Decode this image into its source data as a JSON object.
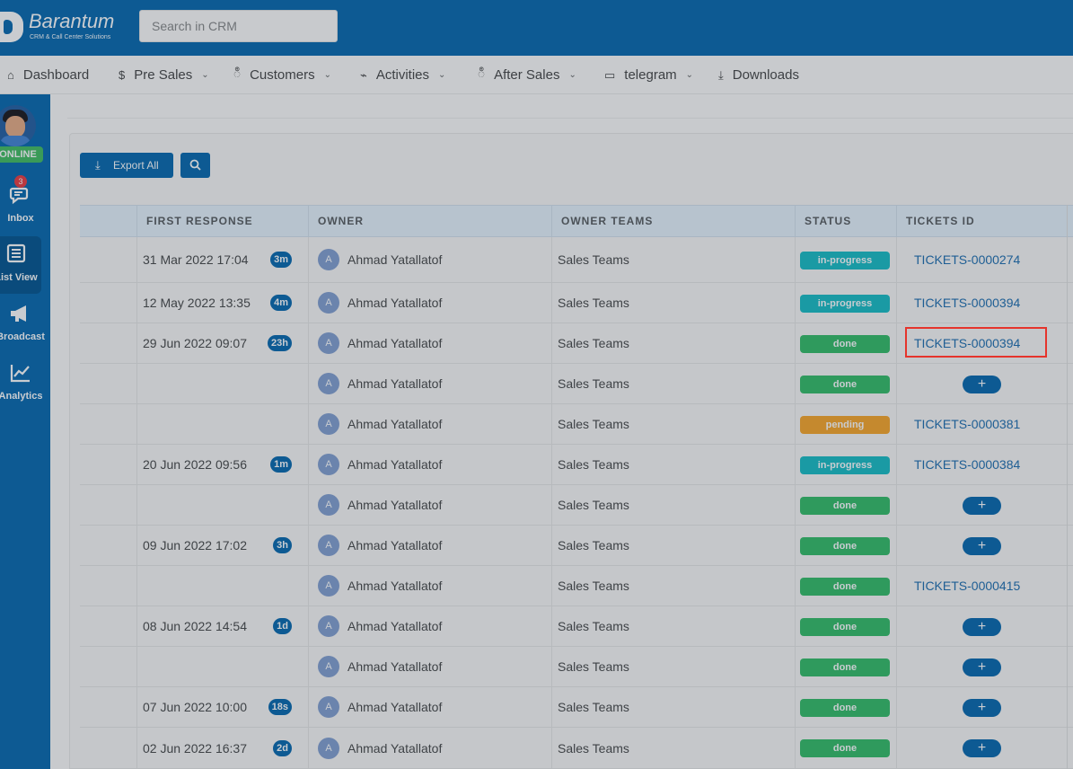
{
  "header": {
    "logo_name": "Barantum",
    "logo_sub": "CRM & Call Center Solutions",
    "search_placeholder": "Search in CRM"
  },
  "nav": [
    {
      "label": "Dashboard",
      "icon": "home-icon",
      "glyph": "⌂",
      "dropdown": false
    },
    {
      "label": "Pre Sales",
      "icon": "dollar-icon",
      "glyph": "$",
      "dropdown": true
    },
    {
      "label": "Customers",
      "icon": "users-icon",
      "glyph": "ဳ",
      "dropdown": true
    },
    {
      "label": "Activities",
      "icon": "activity-icon",
      "glyph": "⌁",
      "dropdown": true
    },
    {
      "label": "After Sales",
      "icon": "support-icon",
      "glyph": "ဳ",
      "dropdown": true
    },
    {
      "label": "telegram",
      "icon": "folder-icon",
      "glyph": "▭",
      "dropdown": true
    },
    {
      "label": "Downloads",
      "icon": "download-icon",
      "glyph": "⤓",
      "dropdown": false
    }
  ],
  "sidebar": {
    "status": "ONLINE",
    "items": [
      {
        "label": "Inbox",
        "icon": "chat-icon",
        "badge": "3"
      },
      {
        "label": "List View",
        "icon": "list-icon",
        "active": true
      },
      {
        "label": "Broadcast",
        "icon": "megaphone-icon"
      },
      {
        "label": "Analytics",
        "icon": "chart-icon"
      }
    ]
  },
  "toolbar": {
    "export_label": "Export All"
  },
  "table": {
    "headers": [
      "FIRST RESPONSE",
      "OWNER",
      "OWNER TEAMS",
      "STATUS",
      "TICKETS ID"
    ],
    "rows": [
      {
        "date": "31 Mar 2022 17:04",
        "dur": "3m",
        "owner": "Ahmad Yatallatof",
        "team": "Sales Teams",
        "status": "in-progress",
        "ticket": "TICKETS-0000274"
      },
      {
        "date": "12 May 2022 13:35",
        "dur": "4m",
        "owner": "Ahmad Yatallatof",
        "team": "Sales Teams",
        "status": "in-progress",
        "ticket": "TICKETS-0000394"
      },
      {
        "date": "29 Jun 2022 09:07",
        "dur": "23h",
        "owner": "Ahmad Yatallatof",
        "team": "Sales Teams",
        "status": "done",
        "ticket": "TICKETS-0000394"
      },
      {
        "date": "",
        "dur": "",
        "owner": "Ahmad Yatallatof",
        "team": "Sales Teams",
        "status": "done",
        "ticket": ""
      },
      {
        "date": "",
        "dur": "",
        "owner": "Ahmad Yatallatof",
        "team": "Sales Teams",
        "status": "pending",
        "ticket": "TICKETS-0000381"
      },
      {
        "date": "20 Jun 2022 09:56",
        "dur": "1m",
        "owner": "Ahmad Yatallatof",
        "team": "Sales Teams",
        "status": "in-progress",
        "ticket": "TICKETS-0000384"
      },
      {
        "date": "",
        "dur": "",
        "owner": "Ahmad Yatallatof",
        "team": "Sales Teams",
        "status": "done",
        "ticket": ""
      },
      {
        "date": "09 Jun 2022 17:02",
        "dur": "3h",
        "owner": "Ahmad Yatallatof",
        "team": "Sales Teams",
        "status": "done",
        "ticket": ""
      },
      {
        "date": "",
        "dur": "",
        "owner": "Ahmad Yatallatof",
        "team": "Sales Teams",
        "status": "done",
        "ticket": "TICKETS-0000415"
      },
      {
        "date": "08 Jun 2022 14:54",
        "dur": "1d",
        "owner": "Ahmad Yatallatof",
        "team": "Sales Teams",
        "status": "done",
        "ticket": ""
      },
      {
        "date": "",
        "dur": "",
        "owner": "Ahmad Yatallatof",
        "team": "Sales Teams",
        "status": "done",
        "ticket": ""
      },
      {
        "date": "07 Jun 2022 10:00",
        "dur": "18s",
        "owner": "Ahmad Yatallatof",
        "team": "Sales Teams",
        "status": "done",
        "ticket": ""
      },
      {
        "date": "02 Jun 2022 16:37",
        "dur": "2d",
        "owner": "Ahmad Yatallatof",
        "team": "Sales Teams",
        "status": "done",
        "ticket": ""
      }
    ],
    "owner_initial": "A",
    "add_label": "+"
  }
}
